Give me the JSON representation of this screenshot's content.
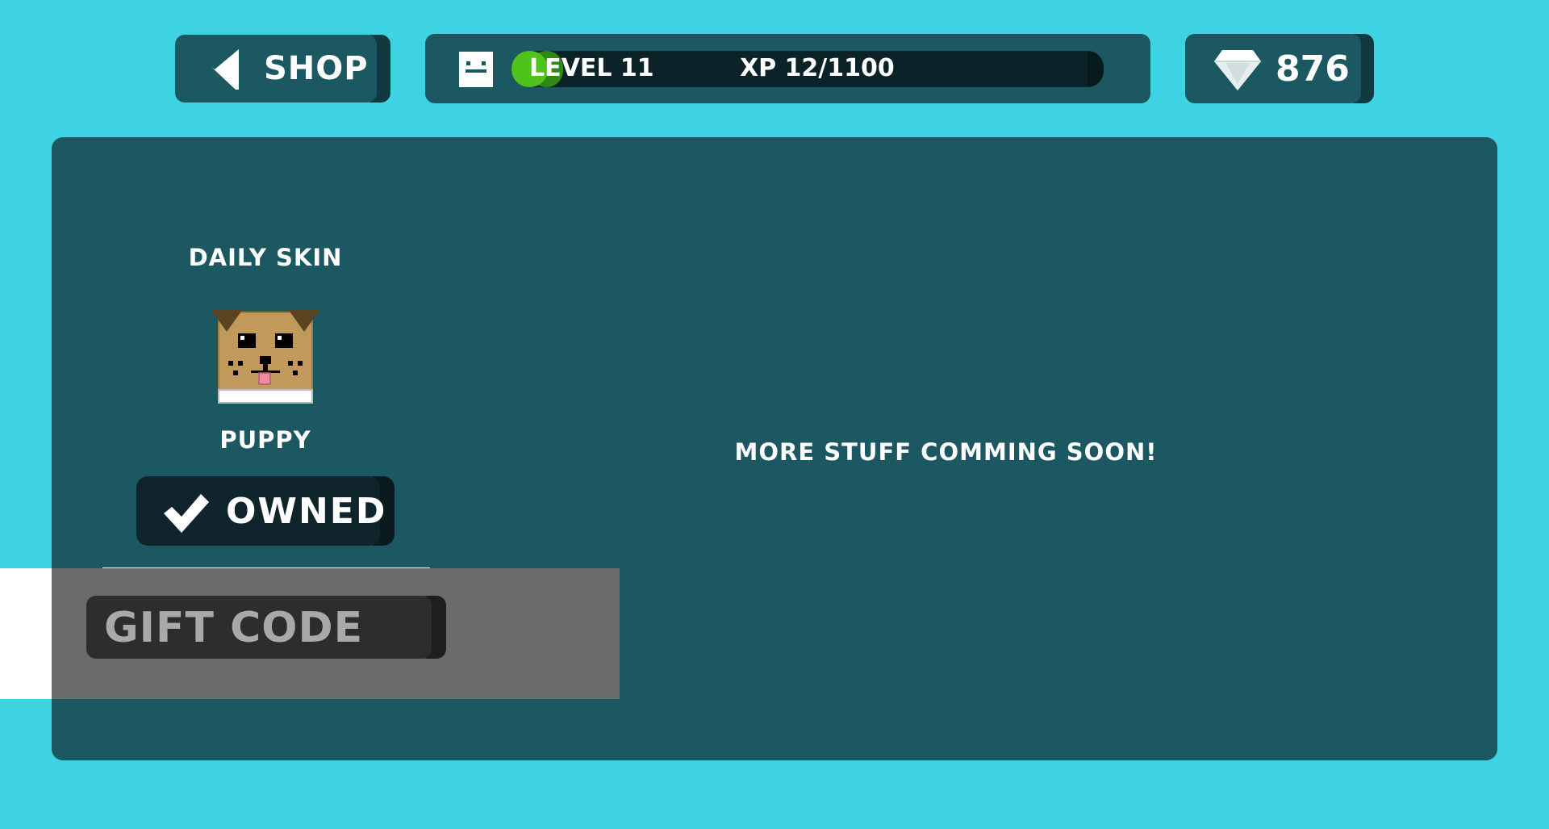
{
  "header": {
    "shop_label": "SHOP",
    "level_label": "LEVEL 11",
    "xp_label": "XP 12/1100",
    "xp_progress": 0.011,
    "gems": "876"
  },
  "daily": {
    "title": "DAILY SKIN",
    "skin_name": "PUPPY",
    "owned_label": "OWNED"
  },
  "gift": {
    "label": "GIFT CODE"
  },
  "main": {
    "coming_soon": "MORE STUFF COMMING SOON!"
  },
  "icons": {
    "back": "chevron-left-icon",
    "player": "player-face-icon",
    "gem": "diamond-icon",
    "check": "checkmark-icon",
    "puppy": "puppy-skin-icon"
  },
  "colors": {
    "background": "#3dd3e2",
    "panel": "#1c5862",
    "xp_fill": "#4fc21c",
    "gift_overlay": "#6b6b6b"
  }
}
